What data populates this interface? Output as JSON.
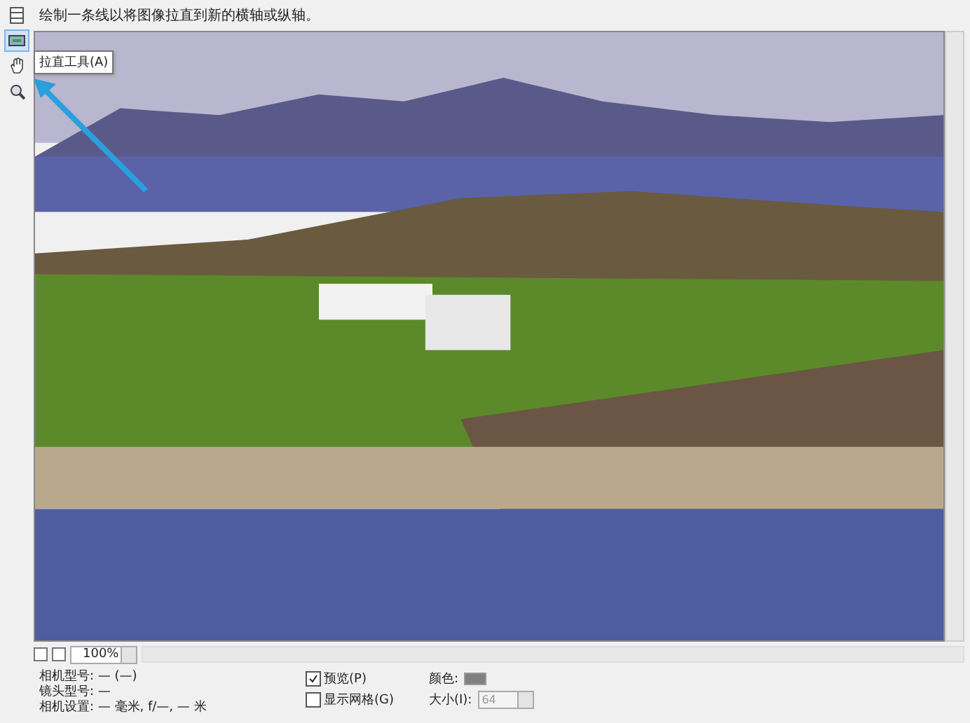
{
  "hint": "绘制一条线以将图像拉直到新的横轴或纵轴。",
  "tools": [
    {
      "kind": "grid",
      "selected": false
    },
    {
      "kind": "straighten",
      "selected": true
    },
    {
      "kind": "hand",
      "selected": false
    },
    {
      "kind": "zoom",
      "selected": false
    }
  ],
  "tooltip": "拉直工具(A)",
  "zoom": {
    "value": "100%"
  },
  "info": [
    "相机型号: — (—)",
    "镜头型号: —",
    "相机设置: — 毫米, f/—, — 米"
  ],
  "options": [
    {
      "label": "预览(P)",
      "checked": true
    },
    {
      "label": "显示网格(G)",
      "checked": false
    }
  ],
  "color": {
    "label": "颜色:",
    "color": "#808080"
  },
  "size": {
    "label": "大小(I):",
    "value": "64",
    "disabled": true
  }
}
